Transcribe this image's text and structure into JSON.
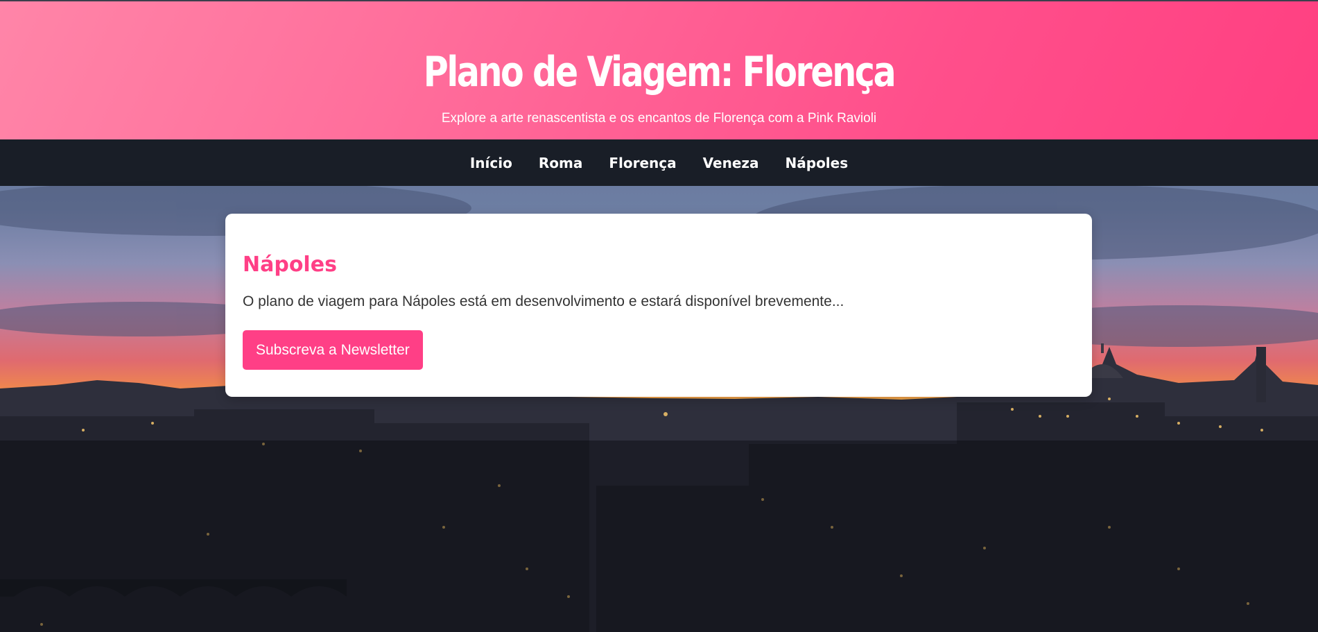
{
  "header": {
    "title": "Plano de Viagem: Florença",
    "subtitle": "Explore a arte renascentista e os encantos de Florença com a Pink Ravioli"
  },
  "nav": {
    "items": [
      {
        "label": "Início"
      },
      {
        "label": "Roma"
      },
      {
        "label": "Florença"
      },
      {
        "label": "Veneza"
      },
      {
        "label": "Nápoles"
      }
    ]
  },
  "card": {
    "title": "Nápoles",
    "text": "O plano de viagem para Nápoles está em desenvolvimento e estará disponível brevemente...",
    "button_label": "Subscreva a Newsletter"
  },
  "colors": {
    "accent": "#ff3f86",
    "header_gradient_start": "#ff85a8",
    "header_gradient_end": "#ff3f81",
    "nav_background": "#161a22"
  }
}
